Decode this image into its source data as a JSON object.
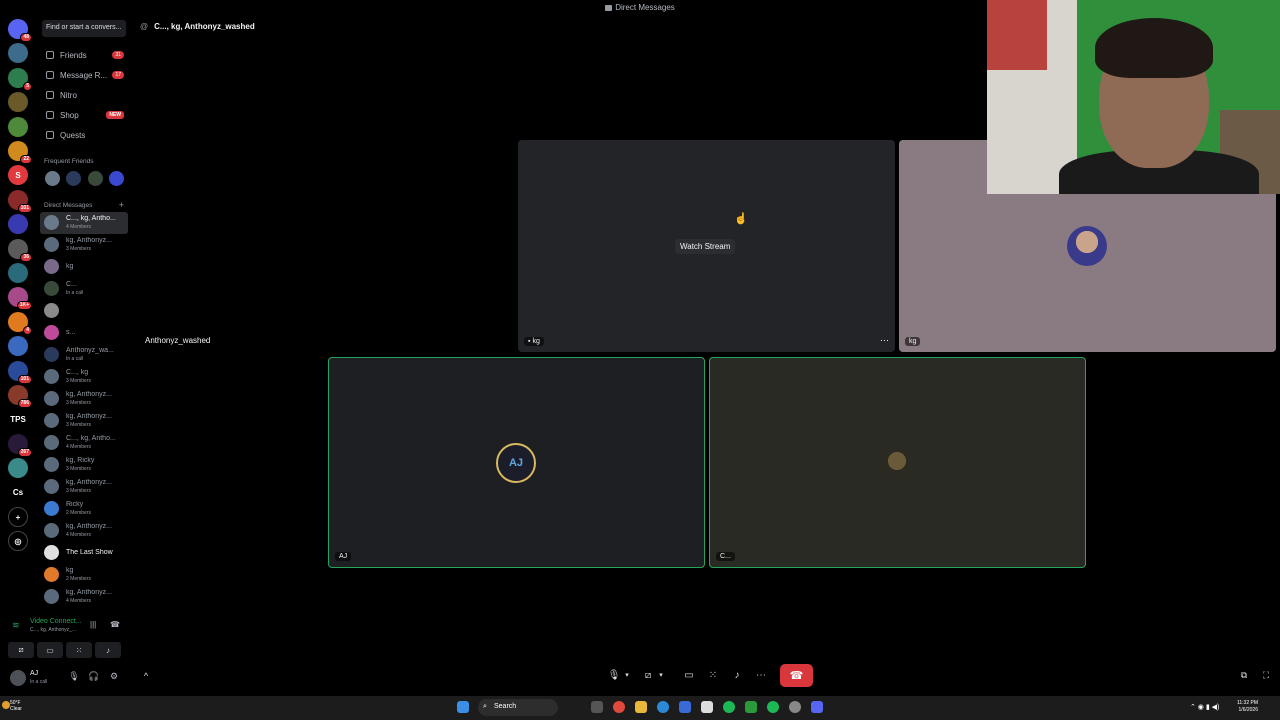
{
  "window": {
    "title": "Direct Messages"
  },
  "rail": {
    "servers": [
      {
        "label": "",
        "color": "#5865f2",
        "badge": "48"
      },
      {
        "label": "",
        "color": "#3c6b8c",
        "badge": ""
      },
      {
        "label": "",
        "color": "#2e7d4f",
        "badge": "5"
      },
      {
        "label": "",
        "color": "#6a5a2a",
        "badge": ""
      },
      {
        "label": "",
        "color": "#4f8a3a",
        "badge": ""
      },
      {
        "label": "",
        "color": "#d08a1e",
        "badge": "22"
      },
      {
        "label": "S",
        "color": "#e03a3e",
        "badge": ""
      },
      {
        "label": "",
        "color": "#8a2a2a",
        "badge": "101"
      },
      {
        "label": "",
        "color": "#3a3ab0",
        "badge": ""
      },
      {
        "label": "",
        "color": "#5a5a5a",
        "badge": "36"
      },
      {
        "label": "",
        "color": "#2a6a7a",
        "badge": ""
      },
      {
        "label": "",
        "color": "#a84a8a",
        "badge": "1K+"
      },
      {
        "label": "",
        "color": "#e07a1e",
        "badge": "4"
      },
      {
        "label": "",
        "color": "#3a6ac0",
        "badge": ""
      },
      {
        "label": "",
        "color": "#2a4a9a",
        "badge": "101"
      },
      {
        "label": "",
        "color": "#8a3a2a",
        "badge": "786"
      },
      {
        "label": "TPS",
        "color": "#000000",
        "badge": ""
      },
      {
        "label": "",
        "color": "#2a1a3a",
        "badge": "267"
      },
      {
        "label": "",
        "color": "#3a8a8a",
        "badge": ""
      },
      {
        "label": "Cs",
        "color": "#000000",
        "badge": ""
      }
    ]
  },
  "sidebar": {
    "search_placeholder": "Find or start a convers...",
    "nav": [
      {
        "label": "Friends",
        "count": "31"
      },
      {
        "label": "Message R...",
        "count": "17"
      },
      {
        "label": "Nitro",
        "count": ""
      },
      {
        "label": "Shop",
        "count": "NEW"
      },
      {
        "label": "Quests",
        "count": ""
      }
    ],
    "frequent_friends_header": "Frequent Friends",
    "dm_header": "Direct Messages",
    "dms": [
      {
        "name": "C..., kg, Antho...",
        "sub": "4 Members",
        "color": "#6b7a8a"
      },
      {
        "name": "kg, Anthonyz...",
        "sub": "3 Members",
        "color": "#5a6a7a"
      },
      {
        "name": "kg",
        "sub": "",
        "color": "#7a6a8a"
      },
      {
        "name": "C...",
        "sub": "In a call",
        "color": "#3a4a3a"
      },
      {
        "name": "",
        "sub": "",
        "color": "#8a8a8a"
      },
      {
        "name": "s...",
        "sub": "",
        "color": "#c04a9a"
      },
      {
        "name": "Anthonyz_wa...",
        "sub": "In a call",
        "color": "#2a3a5a"
      },
      {
        "name": "C..., kg",
        "sub": "3 Members",
        "color": "#5a6a7a"
      },
      {
        "name": "kg, Anthonyz...",
        "sub": "3 Members",
        "color": "#5a6a7a"
      },
      {
        "name": "kg, Anthonyz...",
        "sub": "3 Members",
        "color": "#5a6a7a"
      },
      {
        "name": "C..., kg, Antho...",
        "sub": "4 Members",
        "color": "#5a6a7a"
      },
      {
        "name": "kg, Ricky",
        "sub": "3 Members",
        "color": "#5a6a7a"
      },
      {
        "name": "kg, Anthonyz...",
        "sub": "3 Members",
        "color": "#5a6a7a"
      },
      {
        "name": "Ricky",
        "sub": "2 Members",
        "color": "#3a7ad0"
      },
      {
        "name": "kg, Anthonyz...",
        "sub": "4 Members",
        "color": "#5a6a7a"
      },
      {
        "name": "The Last Show",
        "sub": "",
        "color": "#e0e0e0"
      },
      {
        "name": "kg",
        "sub": "2 Members",
        "color": "#e07a2a"
      },
      {
        "name": "kg, Anthonyz...",
        "sub": "4 Members",
        "color": "#5a6a7a"
      }
    ]
  },
  "voice_panel": {
    "status": "Video Connect...",
    "channel": "C..., kg, Anthonyz_..."
  },
  "user_panel": {
    "name": "AJ",
    "status": "In a call"
  },
  "main": {
    "header_title": "C..., kg, Anthonyz_washed",
    "outside_label": "Anthonyz_washed",
    "tiles": [
      {
        "label": "kg",
        "button": "Watch Stream"
      },
      {
        "label": "kg"
      },
      {
        "label": "AJ"
      },
      {
        "label": "C..."
      }
    ]
  },
  "taskbar": {
    "weather_temp": "50°F",
    "weather_desc": "Clear",
    "search_label": "Search",
    "time": "11:32 PM",
    "date": "1/6/2026"
  },
  "colors": {
    "accent_green": "#23a55a",
    "danger_red": "#da373c",
    "blurple": "#5865f2"
  }
}
